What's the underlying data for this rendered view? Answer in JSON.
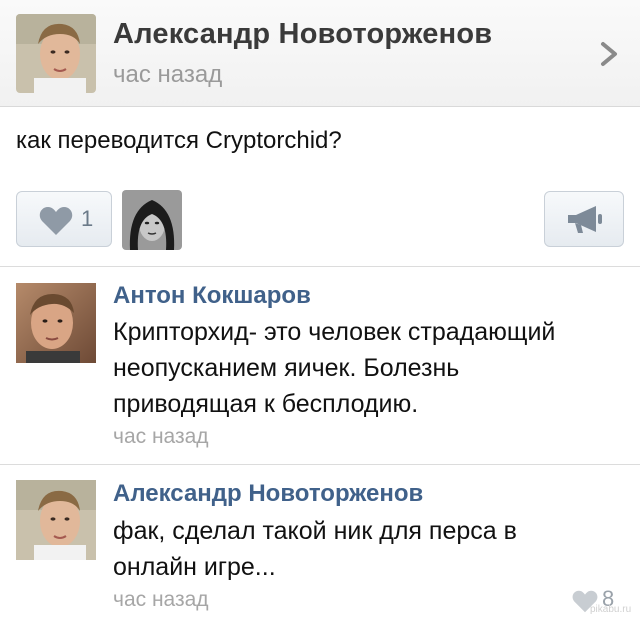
{
  "post": {
    "author_name": "Александр Новоторженов",
    "time": "час назад",
    "text": "как переводится Cryptorchid?",
    "like_count": "1",
    "icons": {
      "chevron": "chevron-right-icon",
      "like": "heart-icon",
      "share": "megaphone-icon"
    }
  },
  "comments": [
    {
      "author": "Антон Кокшаров",
      "lines": [
        "Крипторхид- это человек страдающий",
        "неопусканием яичек. Болезнь",
        "приводящая к бесплодию."
      ],
      "time": "час назад"
    },
    {
      "author": "Александр Новоторженов",
      "lines": [
        "фак, сделал такой ник для перса в",
        "онлайн игре..."
      ],
      "time": "час назад",
      "like_count": "8"
    }
  ],
  "watermark": "pikabu.ru",
  "colors": {
    "author_link": "#40618a",
    "secondary_text": "#9a9a9a",
    "button_border": "#c9d0d8",
    "heart": "#8f9aa6"
  }
}
